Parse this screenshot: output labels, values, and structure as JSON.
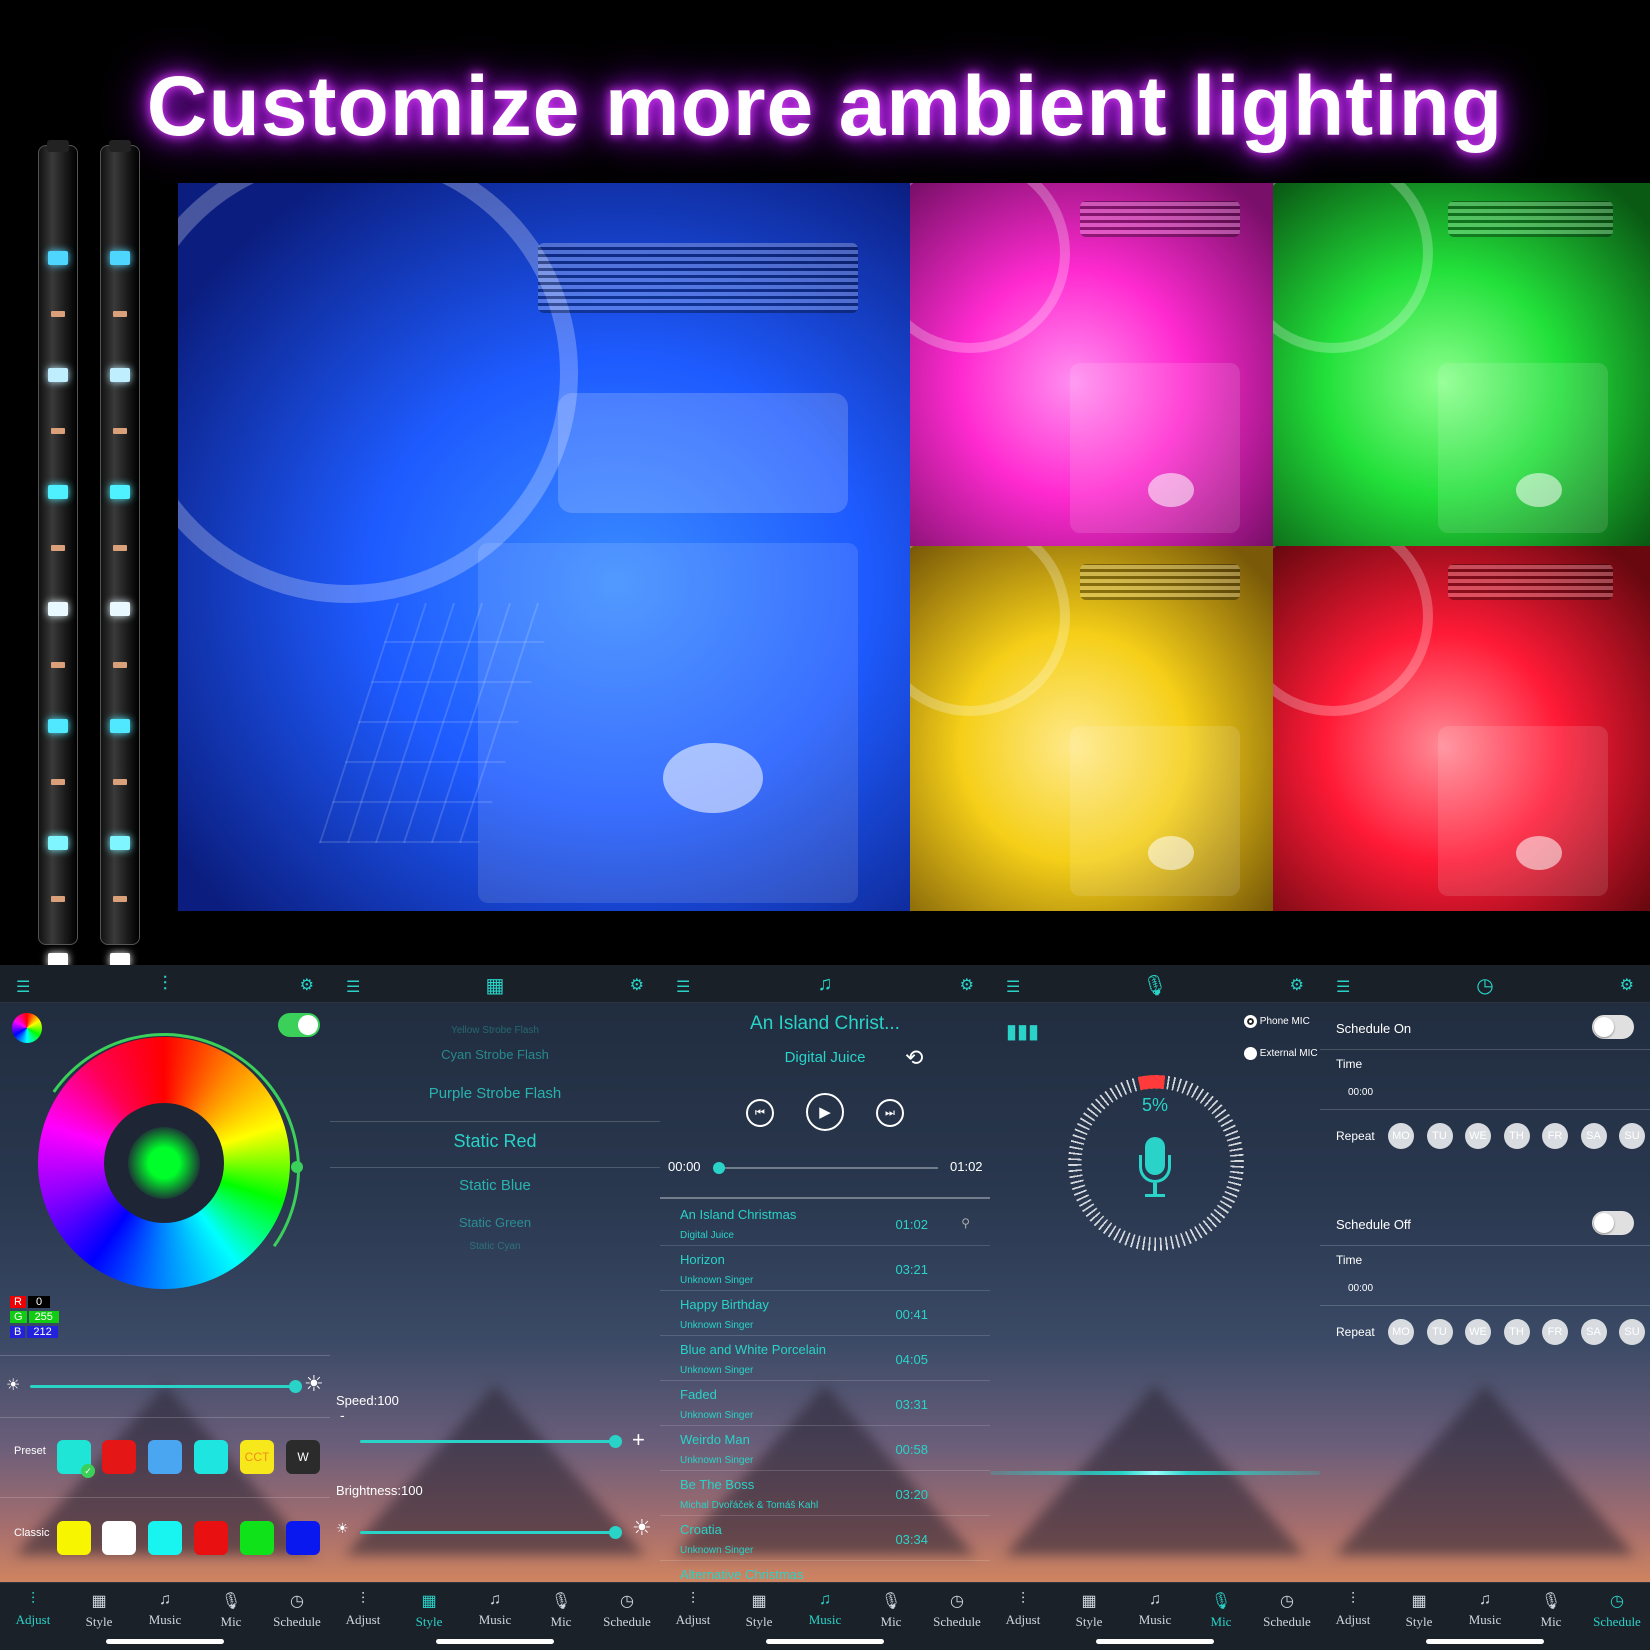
{
  "headline": "Customize more ambient lighting",
  "colors": {
    "accent": "#29d3c8",
    "headline_glow": "#c020ff"
  },
  "photos": [
    {
      "name": "blue",
      "color": "#1e5bff"
    },
    {
      "name": "pink",
      "color": "#ff2ad0"
    },
    {
      "name": "green",
      "color": "#22e03a"
    },
    {
      "name": "yellow",
      "color": "#f5cf18"
    },
    {
      "name": "red",
      "color": "#ff1a36"
    }
  ],
  "nav": {
    "adjust": "Adjust",
    "style": "Style",
    "music": "Music",
    "mic": "Mic",
    "schedule": "Schedule"
  },
  "adjust": {
    "r_label": "R",
    "r_value": "0",
    "g_label": "G",
    "g_value": "255",
    "b_label": "B",
    "b_value": "212",
    "preset_label": "Preset",
    "classic_label": "Classic",
    "cct": "CCT",
    "w": "W",
    "toggle_on": true
  },
  "style": {
    "modes": [
      "Yellow Strobe Flash",
      "Cyan Strobe Flash",
      "Purple Strobe Flash",
      "Static Red",
      "Static Blue",
      "Static Green",
      "Static Cyan"
    ],
    "selected": "Static Red",
    "speed": "Speed:100",
    "brightness": "Brightness:100"
  },
  "music": {
    "title": "An Island Christ...",
    "artist": "Digital Juice",
    "elapsed": "00:00",
    "total": "01:02",
    "progress": 0,
    "songs": [
      {
        "title": "An Island Christmas",
        "artist": "Digital Juice",
        "duration": "01:02"
      },
      {
        "title": "Horizon",
        "artist": "Unknown Singer",
        "duration": "03:21"
      },
      {
        "title": "Happy Birthday",
        "artist": "Unknown Singer",
        "duration": "00:41"
      },
      {
        "title": "Blue and White Porcelain",
        "artist": "Unknown Singer",
        "duration": "04:05"
      },
      {
        "title": "Faded",
        "artist": "Unknown Singer",
        "duration": "03:31"
      },
      {
        "title": "Weirdo Man",
        "artist": "Unknown Singer",
        "duration": "00:58"
      },
      {
        "title": "Be The Boss",
        "artist": "Michal Dvořáček & Tomáš Kahl",
        "duration": "03:20"
      },
      {
        "title": "Croatia",
        "artist": "Unknown Singer",
        "duration": "03:34"
      },
      {
        "title": "Alternative Christmas",
        "artist": "",
        "duration": ""
      }
    ]
  },
  "mic": {
    "phone_mic": "Phone MIC",
    "external_mic": "External MIC",
    "selected": "Phone MIC",
    "level": "5%"
  },
  "schedule": {
    "on_label": "Schedule On",
    "off_label": "Schedule Off",
    "time_label": "Time",
    "time_value": "00:00",
    "repeat_label": "Repeat",
    "days": [
      "MO",
      "TU",
      "WE",
      "TH",
      "FR",
      "SA",
      "SU"
    ]
  }
}
